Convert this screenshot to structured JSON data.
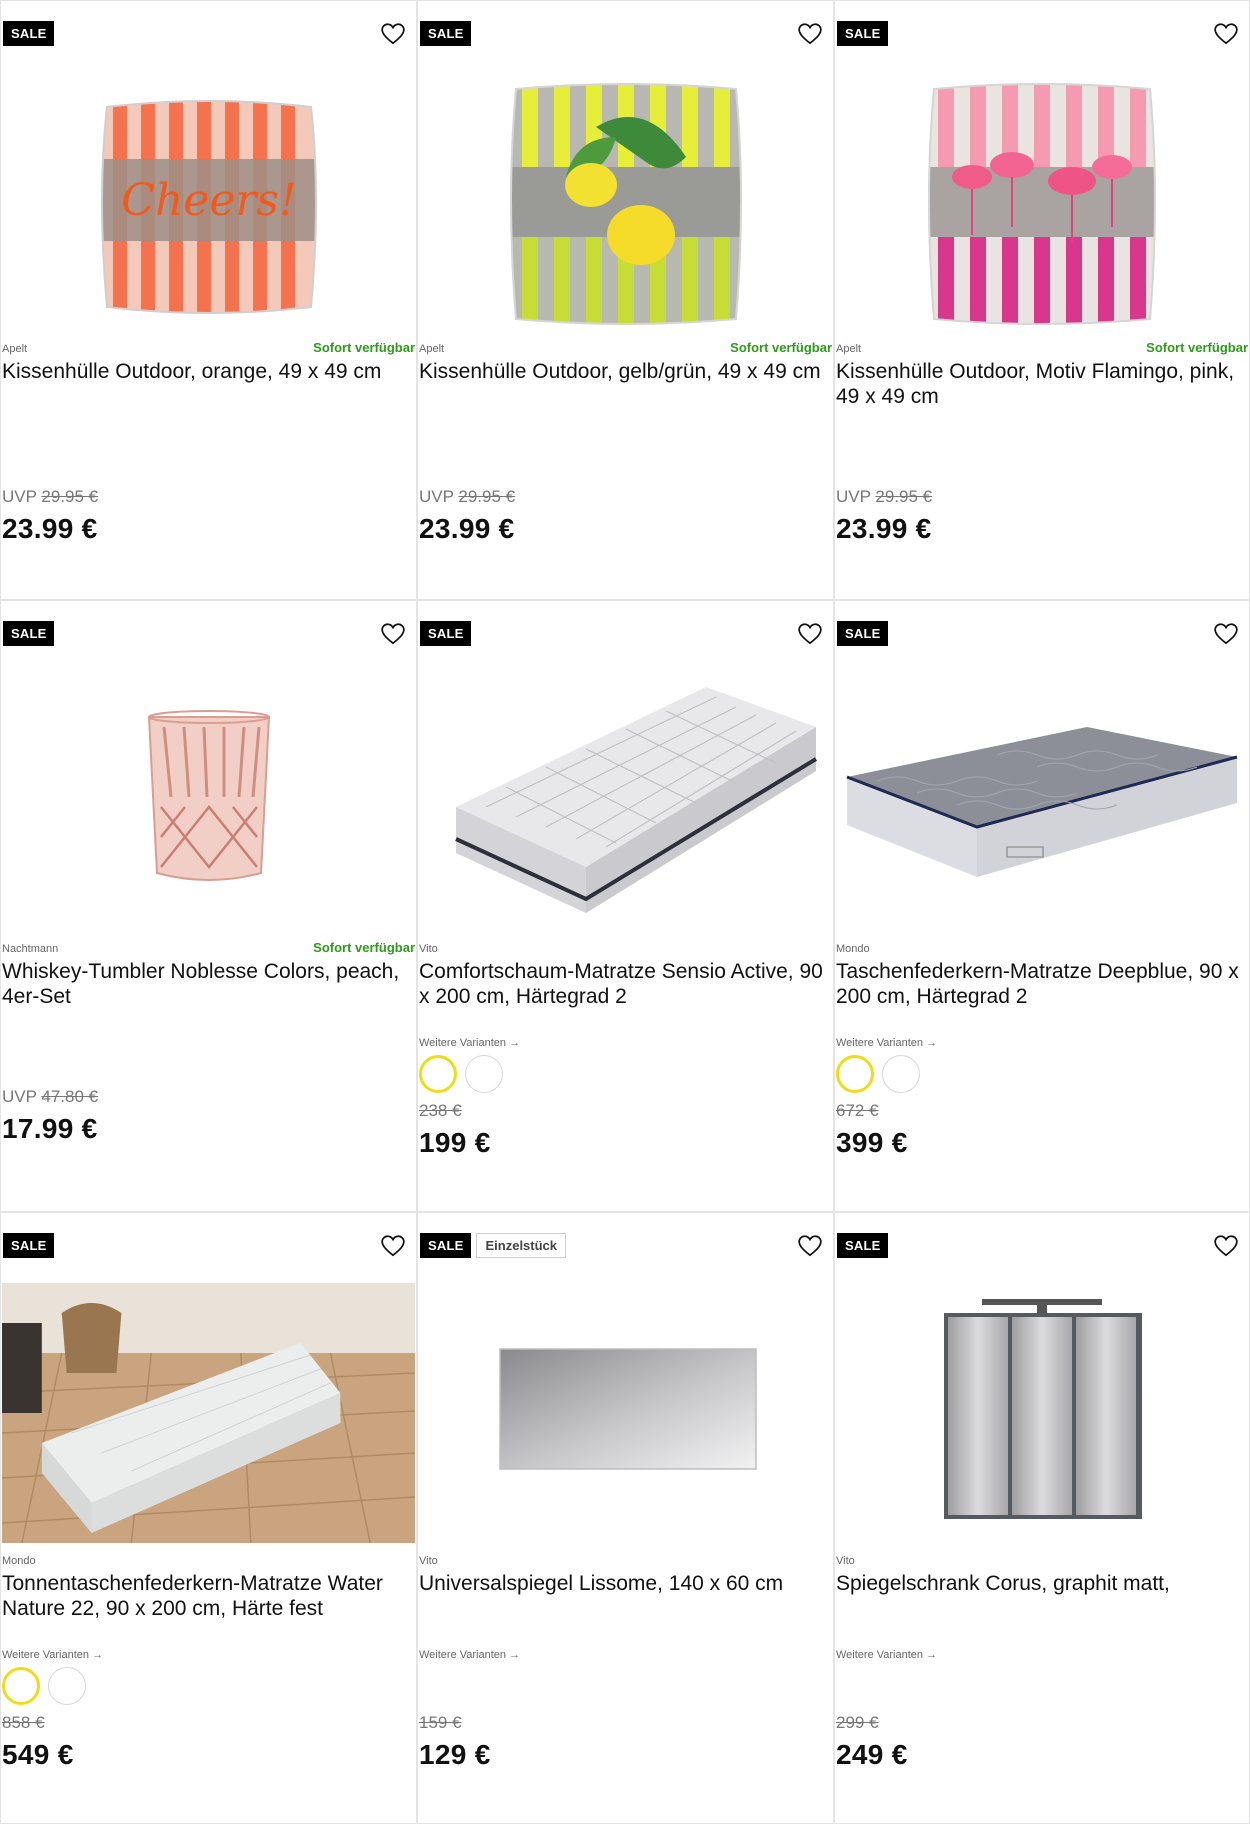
{
  "labels": {
    "sale": "SALE",
    "availability": "Sofort verfügbar",
    "variants": "Weitere Varianten →",
    "uvp": "UVP"
  },
  "products": [
    {
      "brand": "Apelt",
      "title": "Kissenhülle Outdoor, orange, 49 x 49 cm",
      "available": true,
      "old_price": "29.95 €",
      "price": "23.99 €",
      "image": "cushion-orange-cheers",
      "image_text": "Cheers!"
    },
    {
      "brand": "Apelt",
      "title": "Kissenhülle Outdoor, gelb/grün, 49 x 49 cm",
      "available": true,
      "old_price": "29.95 €",
      "price": "23.99 €",
      "image": "cushion-yellow-lemons"
    },
    {
      "brand": "Apelt",
      "title": "Kissenhülle Outdoor, Motiv Flamingo, pink, 49 x 49 cm",
      "available": true,
      "old_price": "29.95 €",
      "price": "23.99 €",
      "image": "cushion-pink-flamingo"
    },
    {
      "brand": "Nachtmann",
      "title": "Whiskey-Tumbler Noblesse Colors, peach, 4er-Set",
      "available": true,
      "old_price": "47.80 €",
      "price": "17.99 €",
      "image": "peach-crystal-tumbler"
    },
    {
      "brand": "Vito",
      "title": "Comfortschaum-Matratze Sensio Active, 90 x 200 cm, Härtegrad 2",
      "old_price": "238 €",
      "price": "199 €",
      "image": "mattress-foam-grey",
      "swatches": [
        "yellow",
        "white"
      ]
    },
    {
      "brand": "Mondo",
      "title": "Taschenfederkern-Matratze Deepblue, 90 x 200 cm, Härtegrad 2",
      "old_price": "672 €",
      "price": "399 €",
      "image": "mattress-pocket-spring",
      "swatches": [
        "yellow",
        "white"
      ]
    },
    {
      "brand": "Mondo",
      "title": "Tonnentaschenfederkern-Matratze Water Nature 22, 90 x 200 cm, Härte fest",
      "old_price": "858 €",
      "price": "549 €",
      "image": "mattress-room-photo",
      "swatches": [
        "yellow",
        "white"
      ]
    },
    {
      "brand": "Vito",
      "title": "Universalspiegel Lissome, 140 x 60 cm",
      "extra_badge": "Einzelstück",
      "old_price": "159 €",
      "price": "129 €",
      "image": "wall-mirror-rect"
    },
    {
      "brand": "Vito",
      "title": "Spiegelschrank Corus, graphit matt,",
      "old_price": "299 €",
      "price": "249 €",
      "image": "mirror-cabinet"
    }
  ],
  "colors": {
    "sale_badge": "#000000",
    "availability": "#2e9b1b",
    "swatch_selected": "#f0dc16",
    "border": "#e4e4e4"
  }
}
